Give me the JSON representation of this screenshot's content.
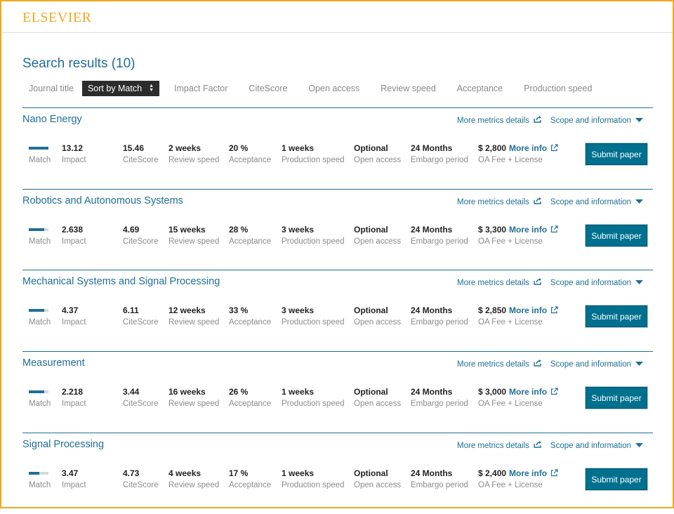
{
  "header": {
    "logo": "ELSEVIER"
  },
  "page": {
    "title": "Search results (10)"
  },
  "sort": {
    "options": [
      "Journal title",
      "Sort by Match",
      "Impact Factor",
      "CiteScore",
      "Open access",
      "Review speed",
      "Acceptance",
      "Production speed"
    ],
    "active": "Sort by Match"
  },
  "labels": {
    "match": "Match",
    "impact": "Impact",
    "citescore": "CiteScore",
    "review": "Review speed",
    "acceptance": "Acceptance",
    "production": "Production speed",
    "open_access": "Open access",
    "embargo": "Embargo period",
    "fee": "OA Fee + License",
    "more_info": "More info",
    "more_metrics": "More metrics details",
    "scope": "Scope and information",
    "submit": "Submit paper"
  },
  "colors": {
    "accent": "#1f6f96",
    "brand": "#f3a81c",
    "button": "#00708f"
  },
  "journals": [
    {
      "name": "Nano Energy",
      "match": 1.0,
      "impact": "13.12",
      "citescore": "15.46",
      "review": "2 weeks",
      "acceptance": "20 %",
      "production": "1 weeks",
      "open_access": "Optional",
      "embargo": "24 Months",
      "fee": "$ 2,800"
    },
    {
      "name": "Robotics and Autonomous Systems",
      "match": 0.8,
      "impact": "2.638",
      "citescore": "4.69",
      "review": "15 weeks",
      "acceptance": "28 %",
      "production": "3 weeks",
      "open_access": "Optional",
      "embargo": "24 Months",
      "fee": "$ 3,300"
    },
    {
      "name": "Mechanical Systems and Signal Processing",
      "match": 0.8,
      "impact": "4.37",
      "citescore": "6.11",
      "review": "12 weeks",
      "acceptance": "33 %",
      "production": "3 weeks",
      "open_access": "Optional",
      "embargo": "24 Months",
      "fee": "$ 2,850"
    },
    {
      "name": "Measurement",
      "match": 0.8,
      "impact": "2.218",
      "citescore": "3.44",
      "review": "16 weeks",
      "acceptance": "26 %",
      "production": "1 weeks",
      "open_access": "Optional",
      "embargo": "24 Months",
      "fee": "$ 3,000"
    },
    {
      "name": "Signal Processing",
      "match": 0.55,
      "impact": "3.47",
      "citescore": "4.73",
      "review": "4 weeks",
      "acceptance": "17 %",
      "production": "1 weeks",
      "open_access": "Optional",
      "embargo": "24 Months",
      "fee": "$ 2,400"
    }
  ]
}
